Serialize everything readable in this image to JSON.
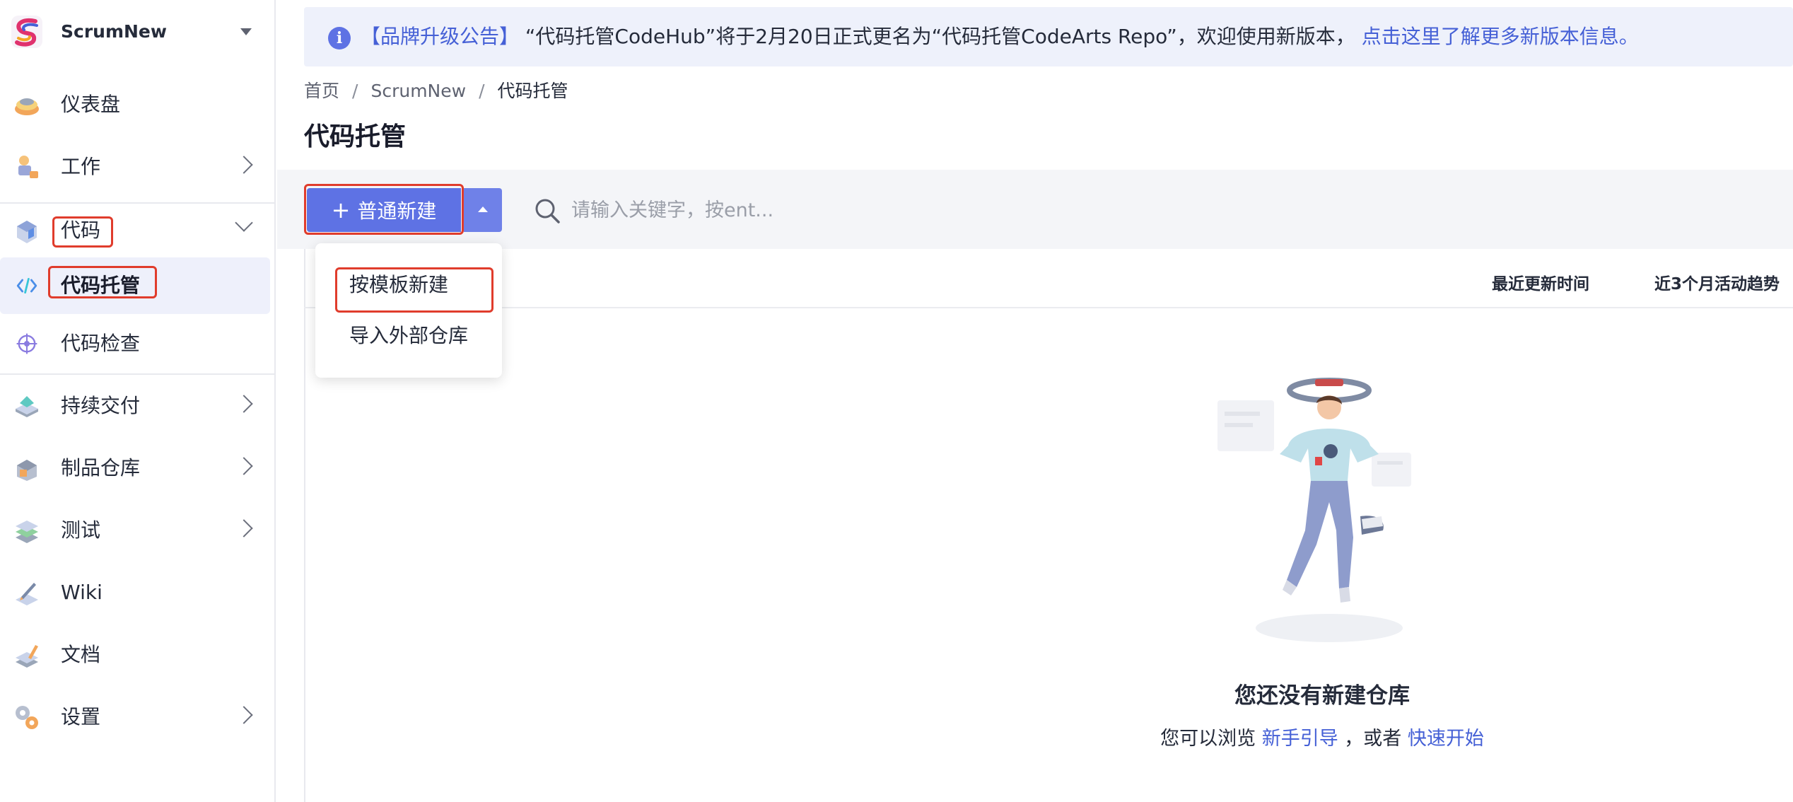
{
  "project": {
    "name": "ScrumNew"
  },
  "sidebar": {
    "items": [
      {
        "label": "仪表盘"
      },
      {
        "label": "工作"
      },
      {
        "label": "代码"
      },
      {
        "label": "代码托管"
      },
      {
        "label": "代码检查"
      },
      {
        "label": "持续交付"
      },
      {
        "label": "制品仓库"
      },
      {
        "label": "测试"
      },
      {
        "label": "Wiki"
      },
      {
        "label": "文档"
      },
      {
        "label": "设置"
      }
    ]
  },
  "notice": {
    "tag": "【品牌升级公告】",
    "text": "“代码托管CodeHub”将于2月20日正式更名为“代码托管CodeArts Repo”，欢迎使用新版本，",
    "link": "点击这里了解更多新版本信息。"
  },
  "breadcrumb": {
    "home": "首页",
    "project": "ScrumNew",
    "current": "代码托管"
  },
  "page": {
    "title": "代码托管"
  },
  "toolbar": {
    "new_button": "普通新建",
    "search_placeholder": "请输入关键字，按ent..."
  },
  "dropdown": {
    "items": [
      "按模板新建",
      "导入外部仓库"
    ]
  },
  "table": {
    "columns": {
      "updated": "最近更新时间",
      "trend": "近3个月活动趋势"
    }
  },
  "empty": {
    "title": "您还没有新建仓库",
    "desc_prefix": "您可以浏览",
    "link_guide": "新手引导",
    "desc_middle": "，或者",
    "link_quickstart": "快速开始"
  },
  "colors": {
    "accent": "#5e72e4",
    "link": "#4560d6",
    "highlight": "#e03c2c",
    "active_bg": "#eef0fb"
  }
}
